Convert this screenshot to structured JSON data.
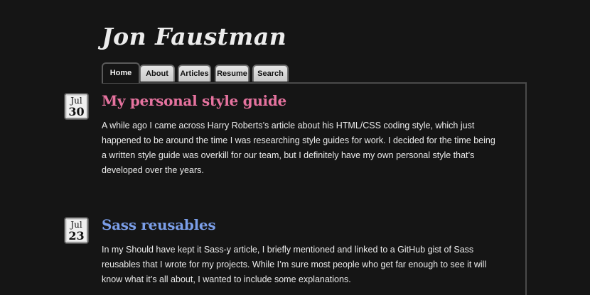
{
  "site": {
    "title": "Jon Faustman"
  },
  "nav": {
    "tabs": [
      {
        "label": "Home"
      },
      {
        "label": "About"
      },
      {
        "label": "Articles"
      },
      {
        "label": "Resume"
      },
      {
        "label": "Search"
      }
    ]
  },
  "posts": [
    {
      "month": "Jul",
      "day": "30",
      "title": "My personal style guide",
      "title_color": "#e6739f",
      "excerpt": "A while ago I came across Harry Roberts’s article about his HTML/CSS coding style, which just happened to be around the time I was researching style guides for work. I decided for the time being a written style guide was overkill for our team, but I definitely have my own personal style that’s developed over the years."
    },
    {
      "month": "Jul",
      "day": "23",
      "title": "Sass reusables",
      "title_color": "#7b9ee8",
      "excerpt": "In my Should have kept it Sass-y article, I briefly mentioned and linked to a GitHub gist of Sass reusables that I wrote for my projects. While I’m sure most people who get far enough to see it will know what it’s all about, I wanted to include some explanations."
    }
  ]
}
